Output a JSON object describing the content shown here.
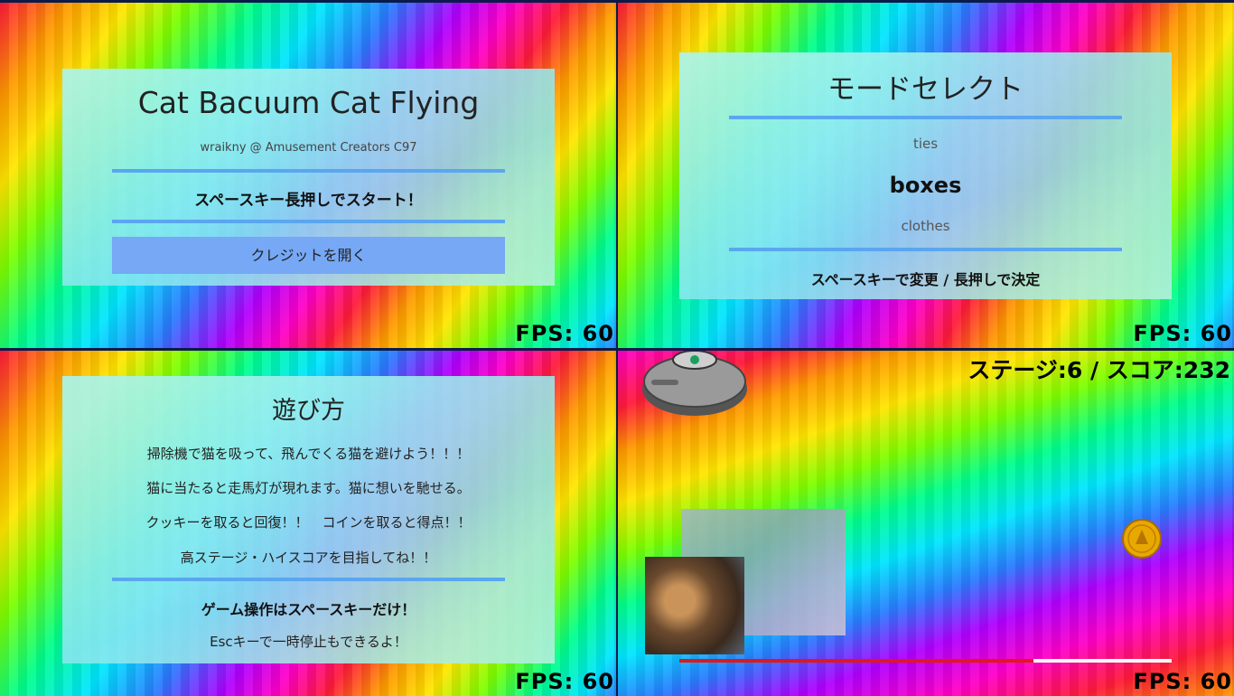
{
  "fps_label": "FPS: 60",
  "title_screen": {
    "title": "Cat Bacuum Cat Flying",
    "credit_line": "wraikny @ Amusement Creators C97",
    "start_prompt": "スペースキー長押しでスタート！",
    "credits_button": "クレジットを開く"
  },
  "mode_select": {
    "title": "モードセレクト",
    "options": [
      "ties",
      "boxes",
      "clothes"
    ],
    "selected": "boxes",
    "hint": "スペースキーで変更 / 長押しで決定"
  },
  "how_to_play": {
    "title": "遊び方",
    "lines": [
      "掃除機で猫を吸って、飛んでくる猫を避けよう！！！",
      "猫に当たると走馬灯が現れます。猫に想いを馳せる。",
      "クッキーを取ると回復！！　コインを取ると得点！！",
      "高ステージ・ハイスコアを目指してね！！"
    ],
    "controls_heading": "ゲーム操作はスペースキーだけ！",
    "pause_hint": "Escキーで一時停止もできるよ！"
  },
  "gameplay": {
    "hud": "ステージ:6 / スコア:232",
    "stage": 6,
    "score": 232,
    "health_fraction": 0.72,
    "colors": {
      "health": "#e01818",
      "health_bg": "#ffffff",
      "coin": "#e8a800"
    },
    "icons": [
      "robot-vacuum-icon",
      "coin-icon",
      "cat-photo"
    ]
  }
}
